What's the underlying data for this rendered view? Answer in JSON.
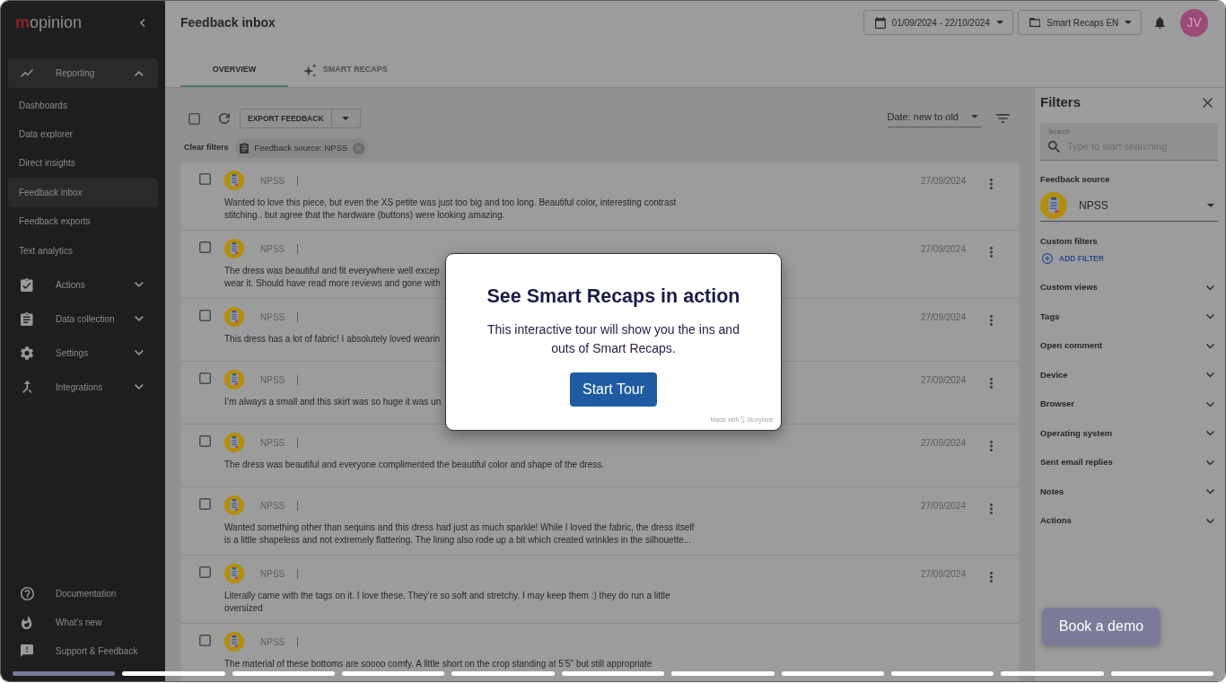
{
  "sidebar": {
    "logo_mark": "m",
    "logo_text": "opinion",
    "nav": [
      {
        "label": "Reporting",
        "expanded": true,
        "children": [
          {
            "label": "Dashboards",
            "selected": false
          },
          {
            "label": "Data explorer",
            "selected": false
          },
          {
            "label": "Direct insights",
            "selected": false
          },
          {
            "label": "Feedback inbox",
            "selected": true
          },
          {
            "label": "Feedback exports",
            "selected": false
          },
          {
            "label": "Text analytics",
            "selected": false
          }
        ]
      },
      {
        "label": "Actions",
        "expanded": false
      },
      {
        "label": "Data collection",
        "expanded": false
      },
      {
        "label": "Settings",
        "expanded": false
      },
      {
        "label": "Integrations",
        "expanded": false
      }
    ],
    "footer_links": [
      "Documentation",
      "What's new",
      "Support & Feedback"
    ]
  },
  "header": {
    "title": "Feedback inbox",
    "date_range": "01/09/2024 - 22/10/2024",
    "project": "Smart Recaps EN",
    "avatar_initials": "JV"
  },
  "tabs": [
    {
      "label": "OVERVIEW",
      "selected": true
    },
    {
      "label": "SMART RECAPS",
      "selected": false
    }
  ],
  "toolbar": {
    "select_all_checked": false,
    "export_button": "EXPORT FEEDBACK",
    "sort": "Date: new to old"
  },
  "active_filters": {
    "clear_label": "Clear filters",
    "chips": [
      "Feedback source: NPSS"
    ]
  },
  "rows": [
    {
      "checked": false,
      "source": "NPSS",
      "date": "27/09/2024",
      "lines": [
        "Wanted to love this piece, but even the XS petite was just too big and too long. Beautiful color, interesting contrast",
        "stitching.. but agree that the hardware (buttons) were looking amazing."
      ]
    },
    {
      "checked": false,
      "source": "NPSS",
      "date": "27/09/2024",
      "lines": [
        "The dress was beautiful and fit everywhere well excep",
        "wear it. Should have read more reviews and gone with"
      ]
    },
    {
      "checked": false,
      "source": "NPSS",
      "date": "27/09/2024",
      "lines": [
        "This dress has a lot of fabric! I absolutely loved wearin"
      ]
    },
    {
      "checked": false,
      "source": "NPSS",
      "date": "27/09/2024",
      "lines": [
        "I’m always a small and this skirt was so huge it was un"
      ]
    },
    {
      "checked": false,
      "source": "NPSS",
      "date": "27/09/2024",
      "lines": [
        "The dress was beautiful and everyone complimented the beautiful color and shape of the dress."
      ]
    },
    {
      "checked": false,
      "source": "NPSS",
      "date": "27/09/2024",
      "lines": [
        "Wanted something other than sequins and this dress had just as much sparkle! While I loved the fabric, the dress itself",
        "is a little shapeless and not extremely flattering. The lining also rode up a bit which created wrinkles in the silhouette..."
      ]
    },
    {
      "checked": false,
      "source": "NPSS",
      "date": "27/09/2024",
      "lines": [
        "Literally came with the tags on it. I love these. They’re so soft and stretchy. I may keep them :) they do run a little",
        "oversized"
      ]
    },
    {
      "checked": false,
      "source": "NPSS",
      "lines": [
        "The material of these bottoms are soooo comfy. A little short on the crop standing at 5’5\" but still appropriate"
      ]
    }
  ],
  "filters_panel": {
    "title": "Filters",
    "search": {
      "label": "Search",
      "placeholder": "Type to start searching"
    },
    "source": {
      "label": "Feedback source",
      "value": "NPSS"
    },
    "custom_filters": {
      "label": "Custom filters",
      "add_button": "ADD FILTER"
    },
    "sections": [
      {
        "label": "Custom views",
        "expanded": false
      },
      {
        "label": "Tags",
        "expanded": false
      },
      {
        "label": "Open comment",
        "expanded": false
      },
      {
        "label": "Device",
        "expanded": false
      },
      {
        "label": "Browser",
        "expanded": false
      },
      {
        "label": "Operating system",
        "expanded": false
      },
      {
        "label": "Sent email replies",
        "expanded": false
      },
      {
        "label": "Notes",
        "expanded": false
      },
      {
        "label": "Actions",
        "expanded": false
      }
    ]
  },
  "tour_modal": {
    "title": "See Smart Recaps in action",
    "body": "This interactive tour will show you the ins and outs of Smart Recaps.",
    "button": "Start Tour",
    "credit_prefix": "Made with",
    "credit_brand": "Storylane"
  },
  "book_demo_button": "Book a demo",
  "tour_steps": [
    {
      "selected": true
    },
    {
      "selected": false
    },
    {
      "selected": false
    },
    {
      "selected": false
    },
    {
      "selected": false
    },
    {
      "selected": false
    },
    {
      "selected": false
    },
    {
      "selected": false
    },
    {
      "selected": false
    },
    {
      "selected": false
    },
    {
      "selected": false
    }
  ]
}
